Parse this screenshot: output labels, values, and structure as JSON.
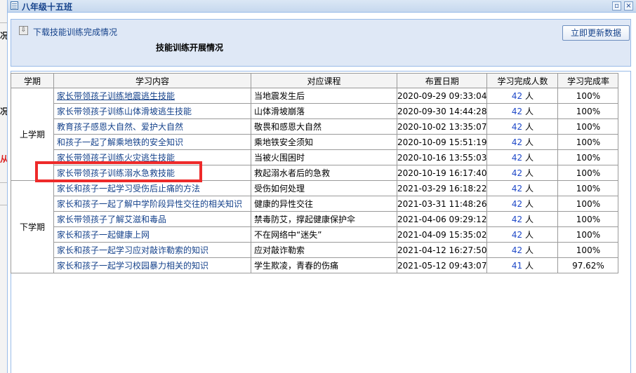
{
  "window": {
    "title": "八年级十五班"
  },
  "panel": {
    "download_link": "下载技能训练完成情况",
    "subtitle": "技能训练开展情况",
    "refresh_button": "立即更新数据"
  },
  "table": {
    "columns": [
      "学期",
      "学习内容",
      "对应课程",
      "布置日期",
      "学习完成人数",
      "学习完成率"
    ],
    "count_unit": "人",
    "terms": [
      {
        "name": "上学期",
        "rows": [
          {
            "content": "家长带领孩子训练地震逃生技能",
            "course": "当地震发生后",
            "date": "2020-09-29 09:33:04",
            "count": "42",
            "rate": "100%",
            "underline": true
          },
          {
            "content": "家长带领孩子训练山体滑坡逃生技能",
            "course": "山体滑坡崩落",
            "date": "2020-09-30 14:44:28",
            "count": "42",
            "rate": "100%",
            "underline": false
          },
          {
            "content": "教育孩子感恩大自然、爱护大自然",
            "course": "敬畏和感恩大自然",
            "date": "2020-10-02 13:35:07",
            "count": "42",
            "rate": "100%",
            "underline": false
          },
          {
            "content": "和孩子一起了解乘地铁的安全知识",
            "course": "乘地铁安全须知",
            "date": "2020-10-09 15:51:19",
            "count": "42",
            "rate": "100%",
            "underline": false
          },
          {
            "content": "家长带领孩子训练火灾逃生技能",
            "course": "当被火围困时",
            "date": "2020-10-16 13:55:03",
            "count": "42",
            "rate": "100%",
            "underline": false
          },
          {
            "content": "家长带领孩子训练溺水急救技能",
            "course": "救起溺水者后的急救",
            "date": "2020-10-19 16:17:40",
            "count": "42",
            "rate": "100%",
            "underline": false
          }
        ]
      },
      {
        "name": "下学期",
        "rows": [
          {
            "content": "家长和孩子一起学习受伤后止痛的方法",
            "course": "受伤如何处理",
            "date": "2021-03-29 16:18:22",
            "count": "42",
            "rate": "100%",
            "underline": false
          },
          {
            "content": "家长和孩子一起了解中学阶段异性交往的相关知识",
            "course": "健康的异性交往",
            "date": "2021-03-31 11:48:26",
            "count": "42",
            "rate": "100%",
            "underline": false
          },
          {
            "content": "家长带领孩子了解艾滋和毒品",
            "course": "禁毒防艾，撑起健康保护伞",
            "date": "2021-04-06 09:29:12",
            "count": "42",
            "rate": "100%",
            "underline": false
          },
          {
            "content": "家长和孩子一起健康上网",
            "course": "不在网络中“迷失”",
            "date": "2021-04-09 15:35:02",
            "count": "42",
            "rate": "100%",
            "underline": false
          },
          {
            "content": "家长和孩子一起学习应对敲诈勒索的知识",
            "course": "应对敲诈勒索",
            "date": "2021-04-12 16:27:50",
            "count": "42",
            "rate": "100%",
            "underline": false
          },
          {
            "content": "家长和孩子一起学习校园暴力相关的知识",
            "course": "学生欺凌，青春的伤痛",
            "date": "2021-05-12 09:43:07",
            "count": "41",
            "rate": "97.62%",
            "underline": false
          }
        ]
      }
    ]
  },
  "background_fragments": [
    "况",
    "况",
    "从"
  ],
  "colors": {
    "link": "#15428b",
    "count": "#1e48c8",
    "highlight": "#ee2a2a",
    "title_bar": "#c6d8ee",
    "panel": "#dfe8f6"
  },
  "icons": {
    "window": "table-icon",
    "download": "download-icon",
    "minimize": "minimize-icon",
    "close": "close-icon"
  }
}
